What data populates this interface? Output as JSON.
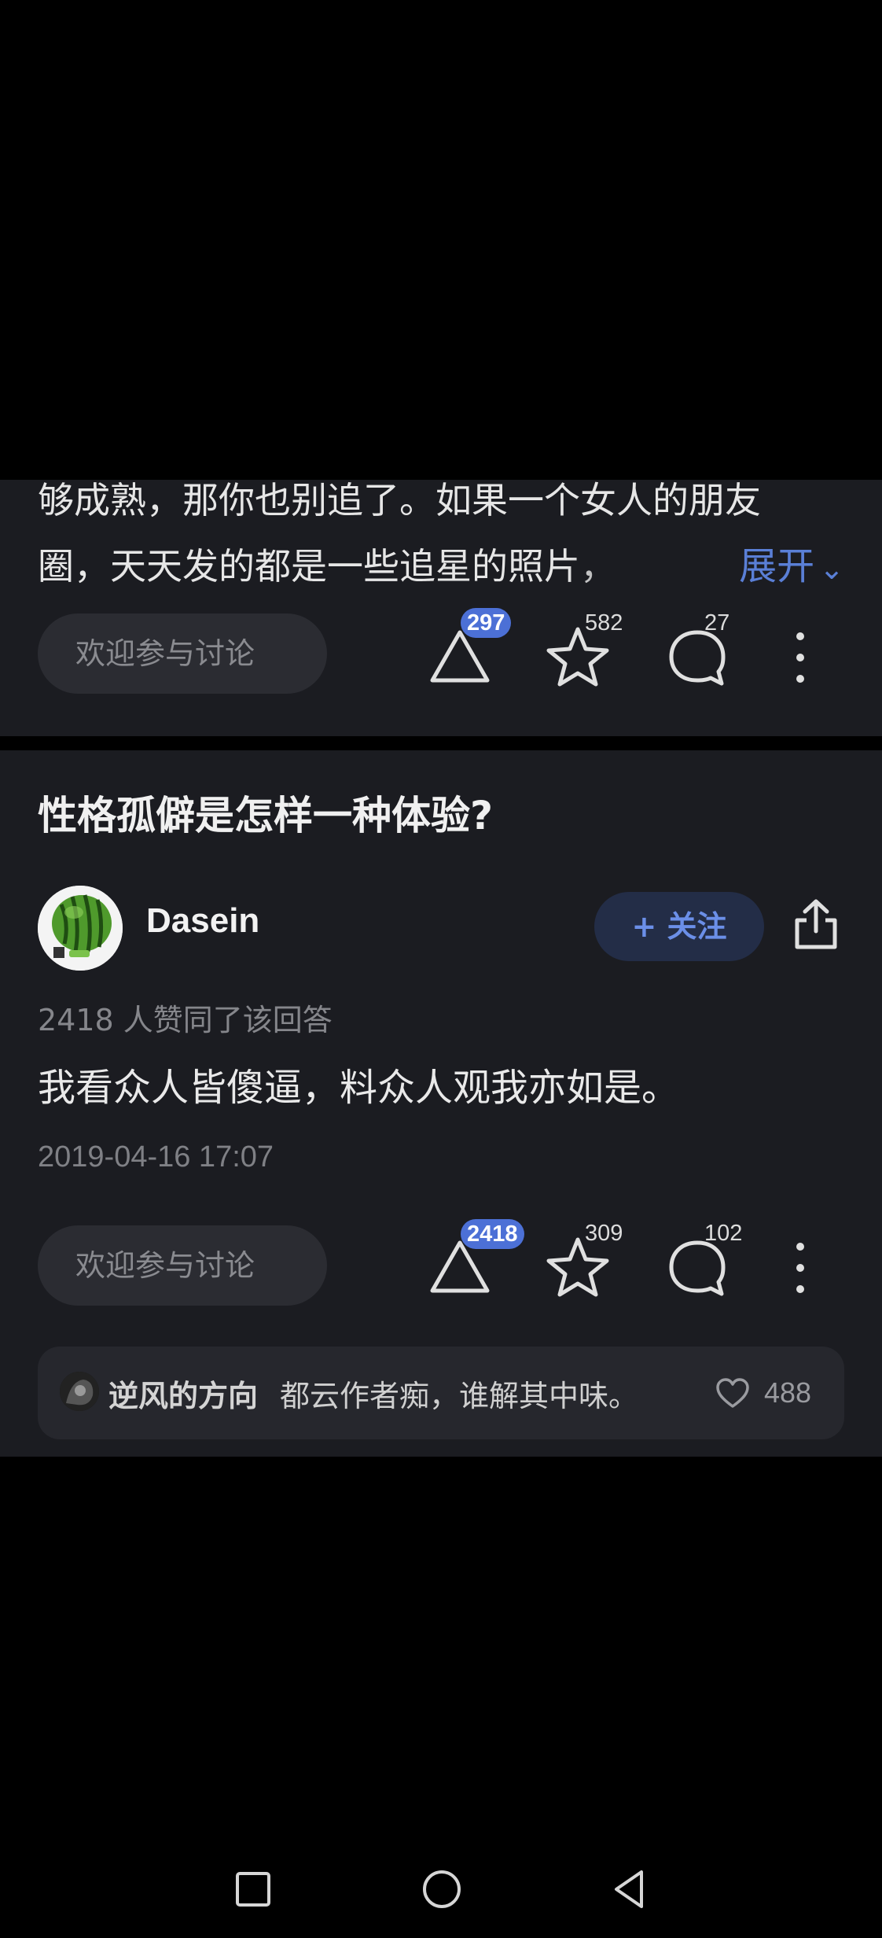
{
  "card1": {
    "excerpt_line1": "够成熟，那你也别追了。如果一个女人的朋友",
    "excerpt_line2": "圈，天天发的都是一些追星的照片，",
    "expand_label": "展开",
    "discuss_placeholder": "欢迎参与讨论",
    "upvotes": "297",
    "favorites": "582",
    "comments": "27"
  },
  "card2": {
    "question_title": "性格孤僻是怎样一种体验?",
    "author_name": "Dasein",
    "follow_label": "+ 关注",
    "agree_text": "2418 人赞同了该回答",
    "answer_text": "我看众人皆傻逼，料众人观我亦如是。",
    "date": "2019-04-16 17:07",
    "discuss_placeholder": "欢迎参与讨论",
    "upvotes": "2418",
    "favorites": "309",
    "comments": "102",
    "top_comment": {
      "user": "逆风的方向",
      "text": "都云作者痴，谁解其中味。",
      "likes": "488"
    }
  },
  "icons": {
    "upvote": "triangle-up-icon",
    "favorite": "star-icon",
    "comment": "speech-bubble-icon",
    "more": "more-vertical-icon",
    "share": "share-icon",
    "like": "heart-icon"
  },
  "colors": {
    "background": "#000000",
    "card": "#1b1c21",
    "accent": "#4c70d6",
    "link": "#5a7fd6"
  }
}
